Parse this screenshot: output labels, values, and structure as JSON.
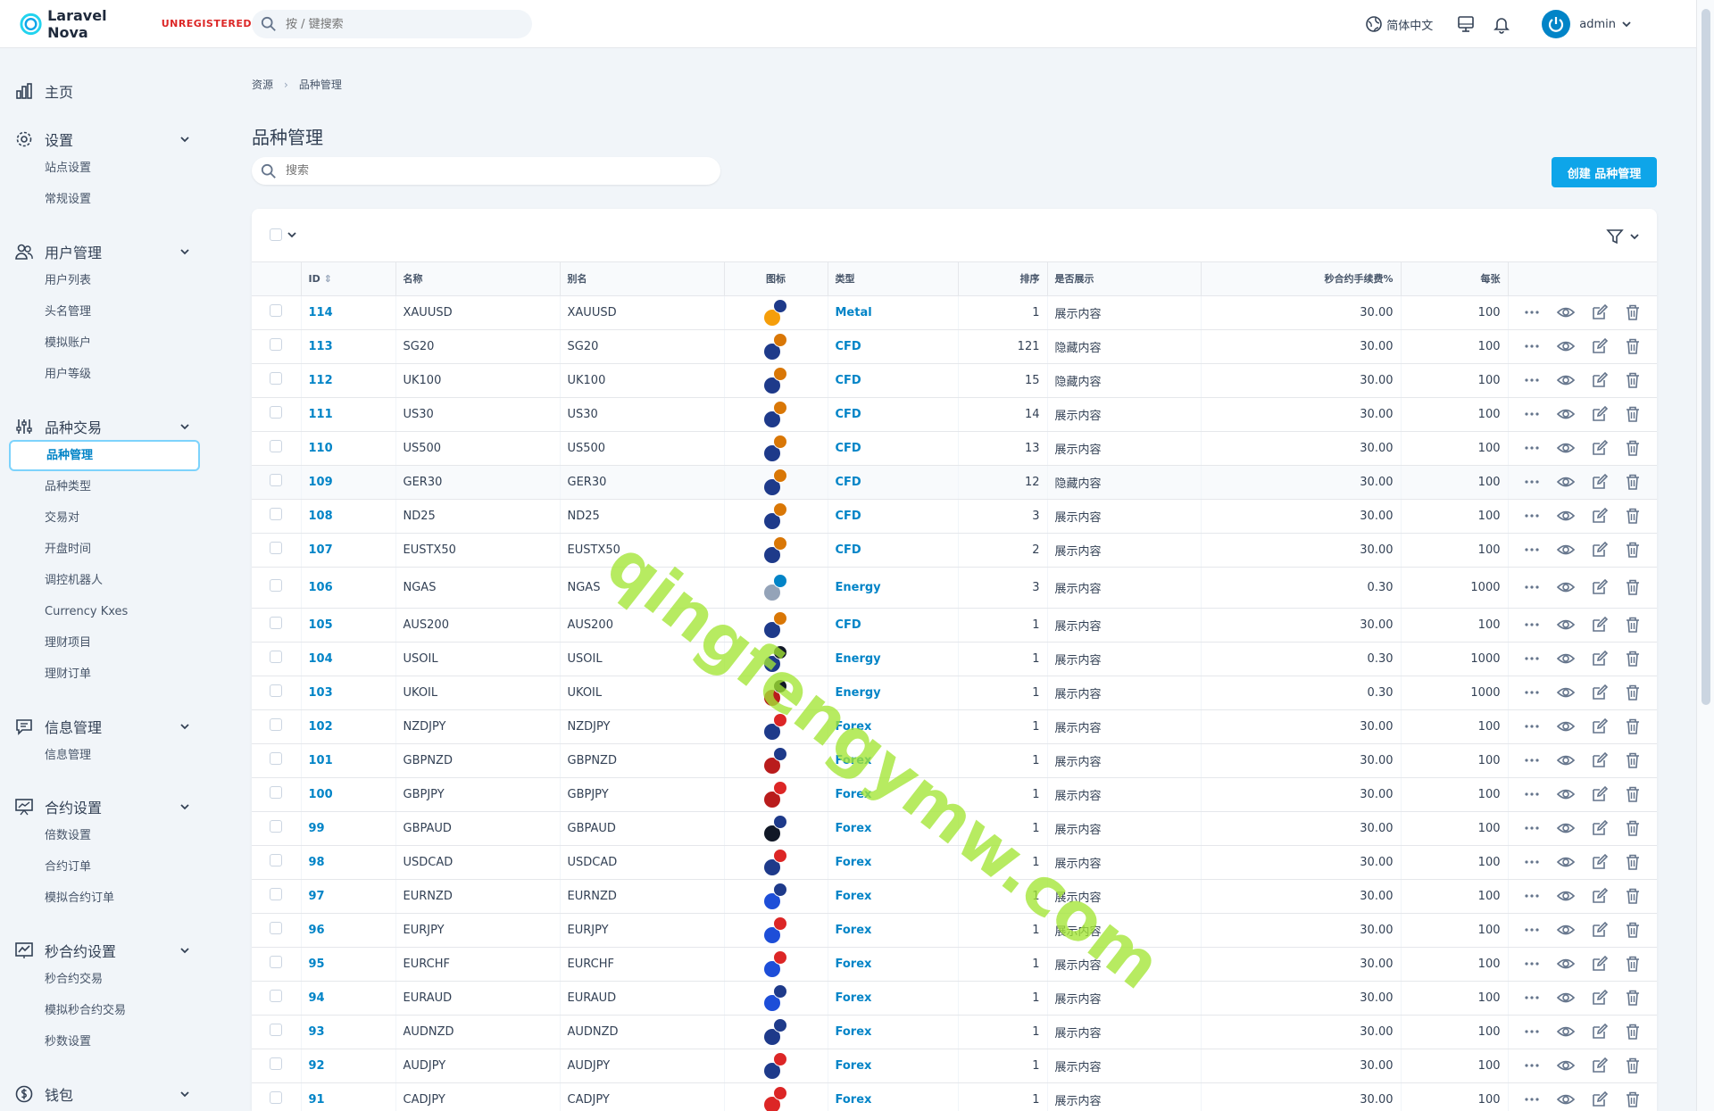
{
  "app": {
    "name": "Laravel Nova",
    "badge": "UNREGISTERED"
  },
  "header": {
    "search_placeholder": "按 / 键搜索",
    "language": "简体中文",
    "user": "admin"
  },
  "sidebar": {
    "home": "主页",
    "groups": [
      {
        "label": "设置",
        "icon": "gear-icon",
        "items": [
          "站点设置",
          "常规设置"
        ]
      },
      {
        "label": "用户管理",
        "icon": "users-icon",
        "items": [
          "用户列表",
          "头名管理",
          "模拟账户",
          "用户等级"
        ]
      },
      {
        "label": "品种交易",
        "icon": "sliders-icon",
        "items": [
          "品种管理",
          "品种类型",
          "交易对",
          "开盘时间",
          "调控机器人",
          "Currency Kxes",
          "理财项目",
          "理财订单"
        ]
      },
      {
        "label": "信息管理",
        "icon": "chat-icon",
        "items": [
          "信息管理"
        ]
      },
      {
        "label": "合约设置",
        "icon": "presentation-chart-icon",
        "items": [
          "倍数设置",
          "合约订单",
          "模拟合约订单"
        ]
      },
      {
        "label": "秒合约设置",
        "icon": "trend-chart-icon",
        "items": [
          "秒合约交易",
          "模拟秒合约交易",
          "秒数设置"
        ]
      },
      {
        "label": "钱包",
        "icon": "currency-icon",
        "items": []
      }
    ],
    "active_item": "品种管理"
  },
  "breadcrumb": {
    "root": "资源",
    "current": "品种管理"
  },
  "page": {
    "title": "品种管理",
    "search_placeholder": "搜索",
    "create_button": "创建 品种管理"
  },
  "table": {
    "columns": [
      "ID",
      "名称",
      "别名",
      "图标",
      "类型",
      "排序",
      "是否展示",
      "秒合约手续费%",
      "每张"
    ],
    "rows": [
      {
        "id": "114",
        "name": "XAUUSD",
        "alias": "XAUUSD",
        "type": "Metal",
        "sort": "1",
        "show": "展示内容",
        "fee": "30.00",
        "per": "100",
        "flag1": "#f59e0b",
        "flag2": "#1e3a8a"
      },
      {
        "id": "113",
        "name": "SG20",
        "alias": "SG20",
        "type": "CFD",
        "sort": "121",
        "show": "隐藏内容",
        "fee": "30.00",
        "per": "100",
        "flag1": "#1e3a8a",
        "flag2": "#d97706"
      },
      {
        "id": "112",
        "name": "UK100",
        "alias": "UK100",
        "type": "CFD",
        "sort": "15",
        "show": "隐藏内容",
        "fee": "30.00",
        "per": "100",
        "flag1": "#1e3a8a",
        "flag2": "#d97706"
      },
      {
        "id": "111",
        "name": "US30",
        "alias": "US30",
        "type": "CFD",
        "sort": "14",
        "show": "展示内容",
        "fee": "30.00",
        "per": "100",
        "flag1": "#1e3a8a",
        "flag2": "#d97706"
      },
      {
        "id": "110",
        "name": "US500",
        "alias": "US500",
        "type": "CFD",
        "sort": "13",
        "show": "展示内容",
        "fee": "30.00",
        "per": "100",
        "flag1": "#1e3a8a",
        "flag2": "#d97706"
      },
      {
        "id": "109",
        "name": "GER30",
        "alias": "GER30",
        "type": "CFD",
        "sort": "12",
        "show": "隐藏内容",
        "fee": "30.00",
        "per": "100",
        "flag1": "#1e3a8a",
        "flag2": "#d97706"
      },
      {
        "id": "108",
        "name": "ND25",
        "alias": "ND25",
        "type": "CFD",
        "sort": "3",
        "show": "展示内容",
        "fee": "30.00",
        "per": "100",
        "flag1": "#1e3a8a",
        "flag2": "#d97706"
      },
      {
        "id": "107",
        "name": "EUSTX50",
        "alias": "EUSTX50",
        "type": "CFD",
        "sort": "2",
        "show": "展示内容",
        "fee": "30.00",
        "per": "100",
        "flag1": "#1e3a8a",
        "flag2": "#d97706"
      },
      {
        "id": "106",
        "name": "NGAS",
        "alias": "NGAS",
        "type": "Energy",
        "sort": "3",
        "show": "展示内容",
        "fee": "0.30",
        "per": "1000",
        "flag1": "#94a3b8",
        "flag2": "#0284c7"
      },
      {
        "id": "105",
        "name": "AUS200",
        "alias": "AUS200",
        "type": "CFD",
        "sort": "1",
        "show": "展示内容",
        "fee": "30.00",
        "per": "100",
        "flag1": "#1e3a8a",
        "flag2": "#d97706"
      },
      {
        "id": "104",
        "name": "USOIL",
        "alias": "USOIL",
        "type": "Energy",
        "sort": "1",
        "show": "展示内容",
        "fee": "0.30",
        "per": "1000",
        "flag1": "#1e3a8a",
        "flag2": "#111827"
      },
      {
        "id": "103",
        "name": "UKOIL",
        "alias": "UKOIL",
        "type": "Energy",
        "sort": "1",
        "show": "展示内容",
        "fee": "0.30",
        "per": "1000",
        "flag1": "#b91c1c",
        "flag2": "#111827"
      },
      {
        "id": "102",
        "name": "NZDJPY",
        "alias": "NZDJPY",
        "type": "Forex",
        "sort": "1",
        "show": "展示内容",
        "fee": "30.00",
        "per": "100",
        "flag1": "#1e3a8a",
        "flag2": "#dc2626"
      },
      {
        "id": "101",
        "name": "GBPNZD",
        "alias": "GBPNZD",
        "type": "Forex",
        "sort": "1",
        "show": "展示内容",
        "fee": "30.00",
        "per": "100",
        "flag1": "#b91c1c",
        "flag2": "#1e3a8a"
      },
      {
        "id": "100",
        "name": "GBPJPY",
        "alias": "GBPJPY",
        "type": "Forex",
        "sort": "1",
        "show": "展示内容",
        "fee": "30.00",
        "per": "100",
        "flag1": "#b91c1c",
        "flag2": "#dc2626"
      },
      {
        "id": "99",
        "name": "GBPAUD",
        "alias": "GBPAUD",
        "type": "Forex",
        "sort": "1",
        "show": "展示内容",
        "fee": "30.00",
        "per": "100",
        "flag1": "#111827",
        "flag2": "#1e3a8a"
      },
      {
        "id": "98",
        "name": "USDCAD",
        "alias": "USDCAD",
        "type": "Forex",
        "sort": "1",
        "show": "展示内容",
        "fee": "30.00",
        "per": "100",
        "flag1": "#1e3a8a",
        "flag2": "#dc2626"
      },
      {
        "id": "97",
        "name": "EURNZD",
        "alias": "EURNZD",
        "type": "Forex",
        "sort": "1",
        "show": "展示内容",
        "fee": "30.00",
        "per": "100",
        "flag1": "#1d4ed8",
        "flag2": "#1e3a8a"
      },
      {
        "id": "96",
        "name": "EURJPY",
        "alias": "EURJPY",
        "type": "Forex",
        "sort": "1",
        "show": "展示内容",
        "fee": "30.00",
        "per": "100",
        "flag1": "#1d4ed8",
        "flag2": "#dc2626"
      },
      {
        "id": "95",
        "name": "EURCHF",
        "alias": "EURCHF",
        "type": "Forex",
        "sort": "1",
        "show": "展示内容",
        "fee": "30.00",
        "per": "100",
        "flag1": "#1d4ed8",
        "flag2": "#dc2626"
      },
      {
        "id": "94",
        "name": "EURAUD",
        "alias": "EURAUD",
        "type": "Forex",
        "sort": "1",
        "show": "展示内容",
        "fee": "30.00",
        "per": "100",
        "flag1": "#1d4ed8",
        "flag2": "#1e3a8a"
      },
      {
        "id": "93",
        "name": "AUDNZD",
        "alias": "AUDNZD",
        "type": "Forex",
        "sort": "1",
        "show": "展示内容",
        "fee": "30.00",
        "per": "100",
        "flag1": "#1e3a8a",
        "flag2": "#1e3a8a"
      },
      {
        "id": "92",
        "name": "AUDJPY",
        "alias": "AUDJPY",
        "type": "Forex",
        "sort": "1",
        "show": "展示内容",
        "fee": "30.00",
        "per": "100",
        "flag1": "#1e3a8a",
        "flag2": "#dc2626"
      },
      {
        "id": "91",
        "name": "CADJPY",
        "alias": "CADJPY",
        "type": "Forex",
        "sort": "1",
        "show": "展示内容",
        "fee": "30.00",
        "per": "100",
        "flag1": "#dc2626",
        "flag2": "#dc2626"
      }
    ]
  },
  "watermark": "qingfengymw.com",
  "colors": {
    "accent": "#0ea5e9",
    "link": "#0284c7",
    "danger": "#dc2626"
  }
}
